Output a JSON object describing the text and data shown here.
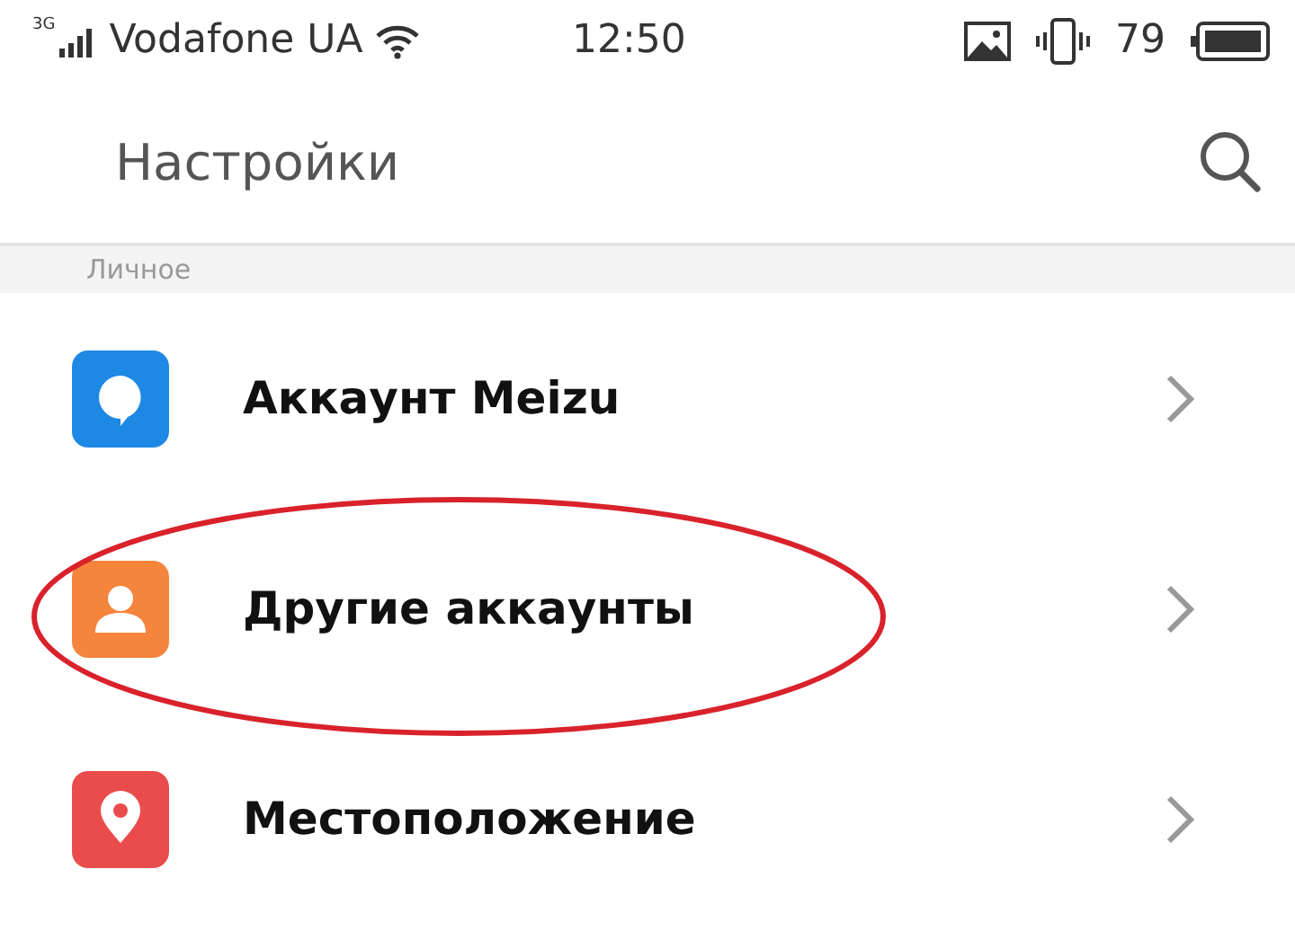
{
  "status_bar": {
    "network": "3G",
    "carrier": "Vodafone UA",
    "time": "12:50",
    "battery": "79"
  },
  "header": {
    "title": "Настройки"
  },
  "section": {
    "title": "Личное"
  },
  "items": [
    {
      "label": "Аккаунт Meizu",
      "kind": "meizu",
      "color": "#1e88e5",
      "circled": false
    },
    {
      "label": "Другие аккаунты",
      "kind": "accounts",
      "color": "#f5843c",
      "circled": true
    },
    {
      "label": "Местоположение",
      "kind": "location",
      "color": "#ea4c4c",
      "circled": false
    }
  ]
}
